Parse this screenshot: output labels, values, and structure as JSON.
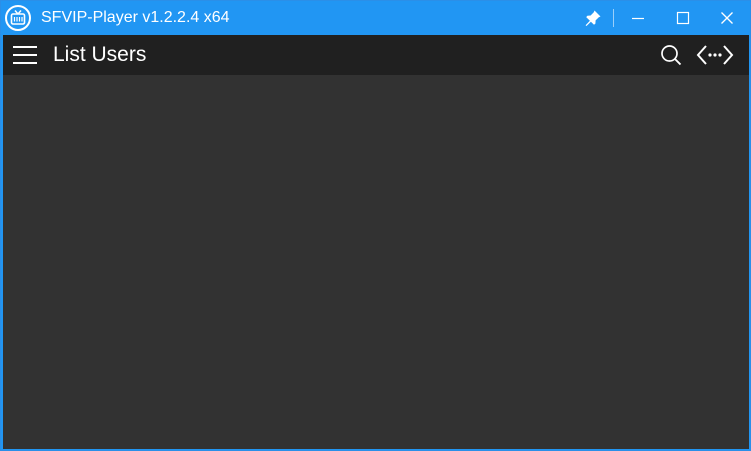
{
  "window": {
    "title": "SFVIP-Player v1.2.2.4 x64"
  },
  "titlebar_buttons": {
    "pin": "pin-icon",
    "minimize": "minimize-icon",
    "maximize": "maximize-icon",
    "close": "close-icon"
  },
  "appbar": {
    "title": "List Users",
    "menu_icon": "hamburger-menu-icon",
    "search_icon": "search-icon",
    "network_icon": "network-connection-icon"
  },
  "colors": {
    "titlebar": "#2196f3",
    "appbar": "#202020",
    "content": "#323232",
    "text": "#ffffff"
  }
}
